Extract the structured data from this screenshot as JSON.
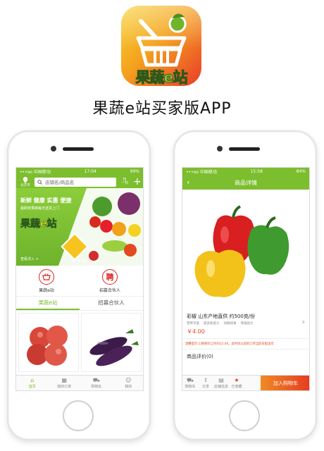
{
  "app": {
    "icon_text": "果蔬e站",
    "title": "果蔬e站买家版APP"
  },
  "phone1": {
    "status": {
      "carrier": "•••oo 中国移动 ",
      "time": "17:04",
      "battery": "99%"
    },
    "header": {
      "location": "北京市",
      "search_placeholder": "店铺名/商品名",
      "scan_label_1": "扫",
      "scan_label_2": "一扫"
    },
    "banner": {
      "tagline": "新鲜 健康 实惠 便捷",
      "subtitle": "最新鲜果蔬每天送货上门",
      "logo": "果蔬e站",
      "more": "查看详入 >"
    },
    "quick_links": [
      {
        "label": "果蔬e站",
        "icon": "basket-icon"
      },
      {
        "label": "招募合伙人",
        "icon": "recruit-icon",
        "glyph": "聘"
      }
    ],
    "tabs": [
      "果蔬e站",
      "招募合伙人"
    ],
    "active_tab": 0,
    "bottom_nav": [
      {
        "label": "首页",
        "icon": "home-icon"
      },
      {
        "label": "我的订单",
        "icon": "orders-icon"
      },
      {
        "label": "购物车",
        "icon": "cart-icon"
      },
      {
        "label": "我的",
        "icon": "user-icon"
      }
    ]
  },
  "phone2": {
    "status": {
      "carrier": "•••oo 中国移动 ",
      "time": "15:58",
      "battery": "84%"
    },
    "header_title": "商品详情",
    "product": {
      "name": "彩椒 山东产地直供 约500克/份",
      "tags": [
        "营养丰富",
        "提高免疫力",
        "润肠排毒",
        "增强视力"
      ],
      "price": "￥4.00"
    },
    "notice": "温馨提示:1)购物车让时间12:00。此时间以前的订单当前日配送可",
    "reviews": "商品评价(0)",
    "bottom_actions": [
      {
        "label": "购物车",
        "icon": "cart-icon"
      },
      {
        "label": "分享",
        "icon": "share-icon"
      },
      {
        "label": "店铺信息",
        "icon": "store-icon"
      },
      {
        "label": "已收藏",
        "icon": "star-icon"
      }
    ],
    "add_to_cart": "加入购物车"
  },
  "colors": {
    "brand_green": "#7cbe2e",
    "accent_red": "#e53b22",
    "price_orange": "#e24a1f"
  }
}
